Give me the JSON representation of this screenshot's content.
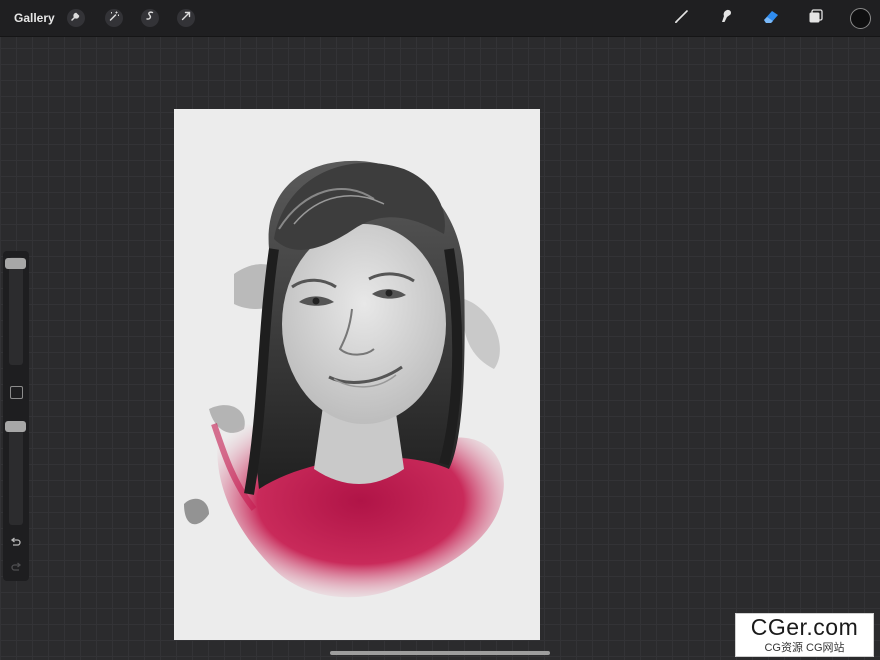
{
  "topbar": {
    "gallery_label": "Gallery",
    "left_tools": [
      {
        "name": "wrench-icon",
        "label": "Actions"
      },
      {
        "name": "magic-wand-icon",
        "label": "Adjustments"
      },
      {
        "name": "selection-icon",
        "label": "Selection"
      },
      {
        "name": "transform-arrow-icon",
        "label": "Transform"
      }
    ],
    "right_tools": [
      {
        "name": "brush-icon",
        "label": "Paint"
      },
      {
        "name": "smudge-icon",
        "label": "Smudge"
      },
      {
        "name": "eraser-icon",
        "label": "Erase",
        "active": true
      },
      {
        "name": "layers-icon",
        "label": "Layers"
      }
    ],
    "color_swatch": "#0f0f10",
    "accent": "#2f8cf0"
  },
  "sidebar": {
    "brush_size_level": 0.0,
    "opacity_level": 0.0
  },
  "canvas": {
    "artwork": "pencil portrait with magenta watercolor wash",
    "paper_color": "#ececec",
    "wash_color": "#c0184b"
  },
  "watermark": {
    "main": "CGer.com",
    "sub": "CG资源 CG网站"
  }
}
